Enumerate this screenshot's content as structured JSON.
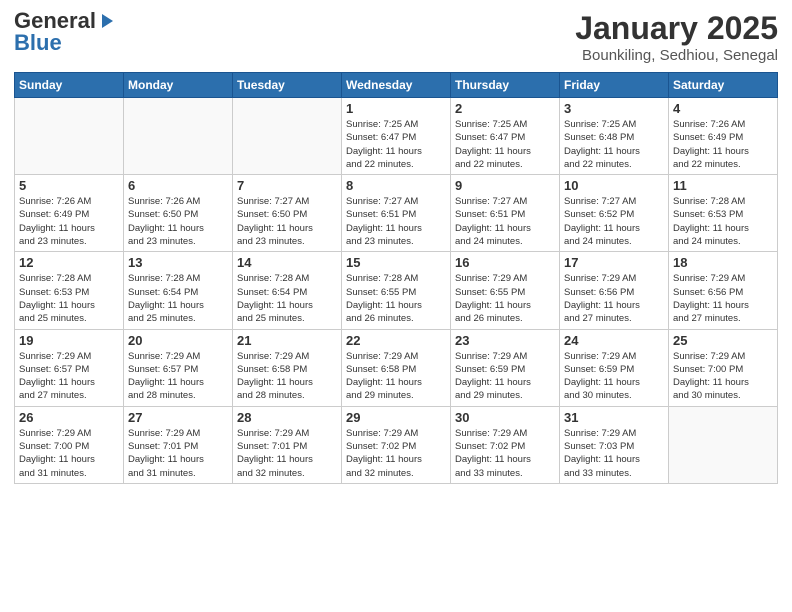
{
  "header": {
    "logo_general": "General",
    "logo_blue": "Blue",
    "month_year": "January 2025",
    "location": "Bounkiling, Sedhiou, Senegal"
  },
  "weekdays": [
    "Sunday",
    "Monday",
    "Tuesday",
    "Wednesday",
    "Thursday",
    "Friday",
    "Saturday"
  ],
  "weeks": [
    [
      {
        "day": "",
        "info": ""
      },
      {
        "day": "",
        "info": ""
      },
      {
        "day": "",
        "info": ""
      },
      {
        "day": "1",
        "info": "Sunrise: 7:25 AM\nSunset: 6:47 PM\nDaylight: 11 hours\nand 22 minutes."
      },
      {
        "day": "2",
        "info": "Sunrise: 7:25 AM\nSunset: 6:47 PM\nDaylight: 11 hours\nand 22 minutes."
      },
      {
        "day": "3",
        "info": "Sunrise: 7:25 AM\nSunset: 6:48 PM\nDaylight: 11 hours\nand 22 minutes."
      },
      {
        "day": "4",
        "info": "Sunrise: 7:26 AM\nSunset: 6:49 PM\nDaylight: 11 hours\nand 22 minutes."
      }
    ],
    [
      {
        "day": "5",
        "info": "Sunrise: 7:26 AM\nSunset: 6:49 PM\nDaylight: 11 hours\nand 23 minutes."
      },
      {
        "day": "6",
        "info": "Sunrise: 7:26 AM\nSunset: 6:50 PM\nDaylight: 11 hours\nand 23 minutes."
      },
      {
        "day": "7",
        "info": "Sunrise: 7:27 AM\nSunset: 6:50 PM\nDaylight: 11 hours\nand 23 minutes."
      },
      {
        "day": "8",
        "info": "Sunrise: 7:27 AM\nSunset: 6:51 PM\nDaylight: 11 hours\nand 23 minutes."
      },
      {
        "day": "9",
        "info": "Sunrise: 7:27 AM\nSunset: 6:51 PM\nDaylight: 11 hours\nand 24 minutes."
      },
      {
        "day": "10",
        "info": "Sunrise: 7:27 AM\nSunset: 6:52 PM\nDaylight: 11 hours\nand 24 minutes."
      },
      {
        "day": "11",
        "info": "Sunrise: 7:28 AM\nSunset: 6:53 PM\nDaylight: 11 hours\nand 24 minutes."
      }
    ],
    [
      {
        "day": "12",
        "info": "Sunrise: 7:28 AM\nSunset: 6:53 PM\nDaylight: 11 hours\nand 25 minutes."
      },
      {
        "day": "13",
        "info": "Sunrise: 7:28 AM\nSunset: 6:54 PM\nDaylight: 11 hours\nand 25 minutes."
      },
      {
        "day": "14",
        "info": "Sunrise: 7:28 AM\nSunset: 6:54 PM\nDaylight: 11 hours\nand 25 minutes."
      },
      {
        "day": "15",
        "info": "Sunrise: 7:28 AM\nSunset: 6:55 PM\nDaylight: 11 hours\nand 26 minutes."
      },
      {
        "day": "16",
        "info": "Sunrise: 7:29 AM\nSunset: 6:55 PM\nDaylight: 11 hours\nand 26 minutes."
      },
      {
        "day": "17",
        "info": "Sunrise: 7:29 AM\nSunset: 6:56 PM\nDaylight: 11 hours\nand 27 minutes."
      },
      {
        "day": "18",
        "info": "Sunrise: 7:29 AM\nSunset: 6:56 PM\nDaylight: 11 hours\nand 27 minutes."
      }
    ],
    [
      {
        "day": "19",
        "info": "Sunrise: 7:29 AM\nSunset: 6:57 PM\nDaylight: 11 hours\nand 27 minutes."
      },
      {
        "day": "20",
        "info": "Sunrise: 7:29 AM\nSunset: 6:57 PM\nDaylight: 11 hours\nand 28 minutes."
      },
      {
        "day": "21",
        "info": "Sunrise: 7:29 AM\nSunset: 6:58 PM\nDaylight: 11 hours\nand 28 minutes."
      },
      {
        "day": "22",
        "info": "Sunrise: 7:29 AM\nSunset: 6:58 PM\nDaylight: 11 hours\nand 29 minutes."
      },
      {
        "day": "23",
        "info": "Sunrise: 7:29 AM\nSunset: 6:59 PM\nDaylight: 11 hours\nand 29 minutes."
      },
      {
        "day": "24",
        "info": "Sunrise: 7:29 AM\nSunset: 6:59 PM\nDaylight: 11 hours\nand 30 minutes."
      },
      {
        "day": "25",
        "info": "Sunrise: 7:29 AM\nSunset: 7:00 PM\nDaylight: 11 hours\nand 30 minutes."
      }
    ],
    [
      {
        "day": "26",
        "info": "Sunrise: 7:29 AM\nSunset: 7:00 PM\nDaylight: 11 hours\nand 31 minutes."
      },
      {
        "day": "27",
        "info": "Sunrise: 7:29 AM\nSunset: 7:01 PM\nDaylight: 11 hours\nand 31 minutes."
      },
      {
        "day": "28",
        "info": "Sunrise: 7:29 AM\nSunset: 7:01 PM\nDaylight: 11 hours\nand 32 minutes."
      },
      {
        "day": "29",
        "info": "Sunrise: 7:29 AM\nSunset: 7:02 PM\nDaylight: 11 hours\nand 32 minutes."
      },
      {
        "day": "30",
        "info": "Sunrise: 7:29 AM\nSunset: 7:02 PM\nDaylight: 11 hours\nand 33 minutes."
      },
      {
        "day": "31",
        "info": "Sunrise: 7:29 AM\nSunset: 7:03 PM\nDaylight: 11 hours\nand 33 minutes."
      },
      {
        "day": "",
        "info": ""
      }
    ]
  ]
}
